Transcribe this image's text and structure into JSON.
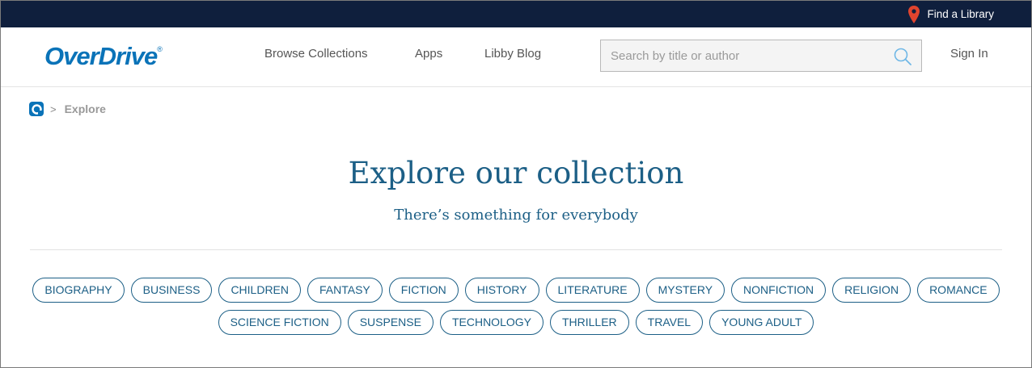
{
  "topbar": {
    "find_library": "Find a Library"
  },
  "header": {
    "logo": "OverDrive",
    "logo_mark": "®",
    "nav": [
      "Browse Collections",
      "Apps",
      "Libby Blog"
    ],
    "search_placeholder": "Search by title or author",
    "sign_in": "Sign In"
  },
  "breadcrumb": {
    "separator": ">",
    "current": "Explore"
  },
  "hero": {
    "title": "Explore our collection",
    "subtitle": "There’s something for everybody"
  },
  "tags_row1": [
    "BIOGRAPHY",
    "BUSINESS",
    "CHILDREN",
    "FANTASY",
    "FICTION",
    "HISTORY",
    "LITERATURE",
    "MYSTERY",
    "NONFICTION",
    "RELIGION",
    "ROMANCE"
  ],
  "tags_row2": [
    "SCIENCE FICTION",
    "SUSPENSE",
    "TECHNOLOGY",
    "THRILLER",
    "TRAVEL",
    "YOUNG ADULT"
  ],
  "colors": {
    "topbar": "#0f1f3d",
    "brand": "#0a73b8",
    "accent": "#1c5f86",
    "pin": "#e0442e"
  },
  "icons": {
    "location": "map-pin-icon",
    "search": "search-icon",
    "home": "overdrive-home-icon"
  }
}
